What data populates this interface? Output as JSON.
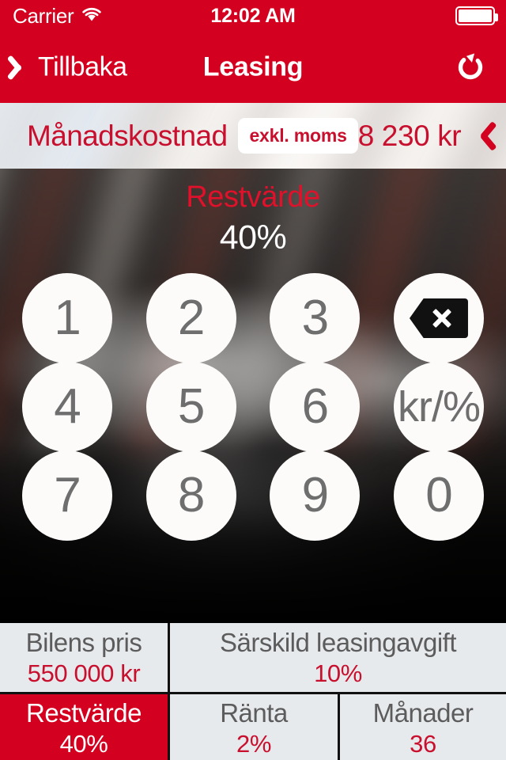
{
  "status_bar": {
    "carrier": "Carrier",
    "wifi_icon": "wifi-icon",
    "time": "12:02 AM",
    "battery_icon": "battery-full-icon"
  },
  "nav_bar": {
    "back_label": "Tillbaka",
    "back_icon": "chevron-left-icon",
    "title": "Leasing",
    "refresh_icon": "refresh-icon"
  },
  "cost_bar": {
    "label": "Månadskostnad",
    "tax_note": "exkl. moms",
    "value": "8 230 kr",
    "chevron_icon": "chevron-right-icon"
  },
  "readout": {
    "label": "Restvärde",
    "value": "40%"
  },
  "keypad": {
    "rows": [
      [
        {
          "label": "1",
          "name": "key-1",
          "type": "digit"
        },
        {
          "label": "2",
          "name": "key-2",
          "type": "digit"
        },
        {
          "label": "3",
          "name": "key-3",
          "type": "digit"
        },
        {
          "label": "",
          "name": "key-backspace",
          "type": "backspace"
        }
      ],
      [
        {
          "label": "4",
          "name": "key-4",
          "type": "digit"
        },
        {
          "label": "5",
          "name": "key-5",
          "type": "digit"
        },
        {
          "label": "6",
          "name": "key-6",
          "type": "digit"
        },
        {
          "label": "kr/%",
          "name": "key-unit-toggle",
          "type": "unit"
        }
      ],
      [
        {
          "label": "7",
          "name": "key-7",
          "type": "digit"
        },
        {
          "label": "8",
          "name": "key-8",
          "type": "digit"
        },
        {
          "label": "9",
          "name": "key-9",
          "type": "digit"
        },
        {
          "label": "0",
          "name": "key-0",
          "type": "digit"
        }
      ]
    ]
  },
  "summary": {
    "row1": [
      {
        "label": "Bilens pris",
        "value": "550 000 kr",
        "active": false,
        "name": "summary-cell-car-price"
      },
      {
        "label": "Särskild leasingavgift",
        "value": "10%",
        "active": false,
        "name": "summary-cell-special-fee"
      }
    ],
    "row2": [
      {
        "label": "Restvärde",
        "value": "40%",
        "active": true,
        "name": "summary-cell-residual-value"
      },
      {
        "label": "Ränta",
        "value": "2%",
        "active": false,
        "name": "summary-cell-interest"
      },
      {
        "label": "Månader",
        "value": "36",
        "active": false,
        "name": "summary-cell-months"
      }
    ]
  },
  "colors": {
    "brand_red": "#D4001F",
    "text_red": "#C8102E",
    "cell_bg": "#E7EAED",
    "key_bg": "#FCFBFA"
  }
}
